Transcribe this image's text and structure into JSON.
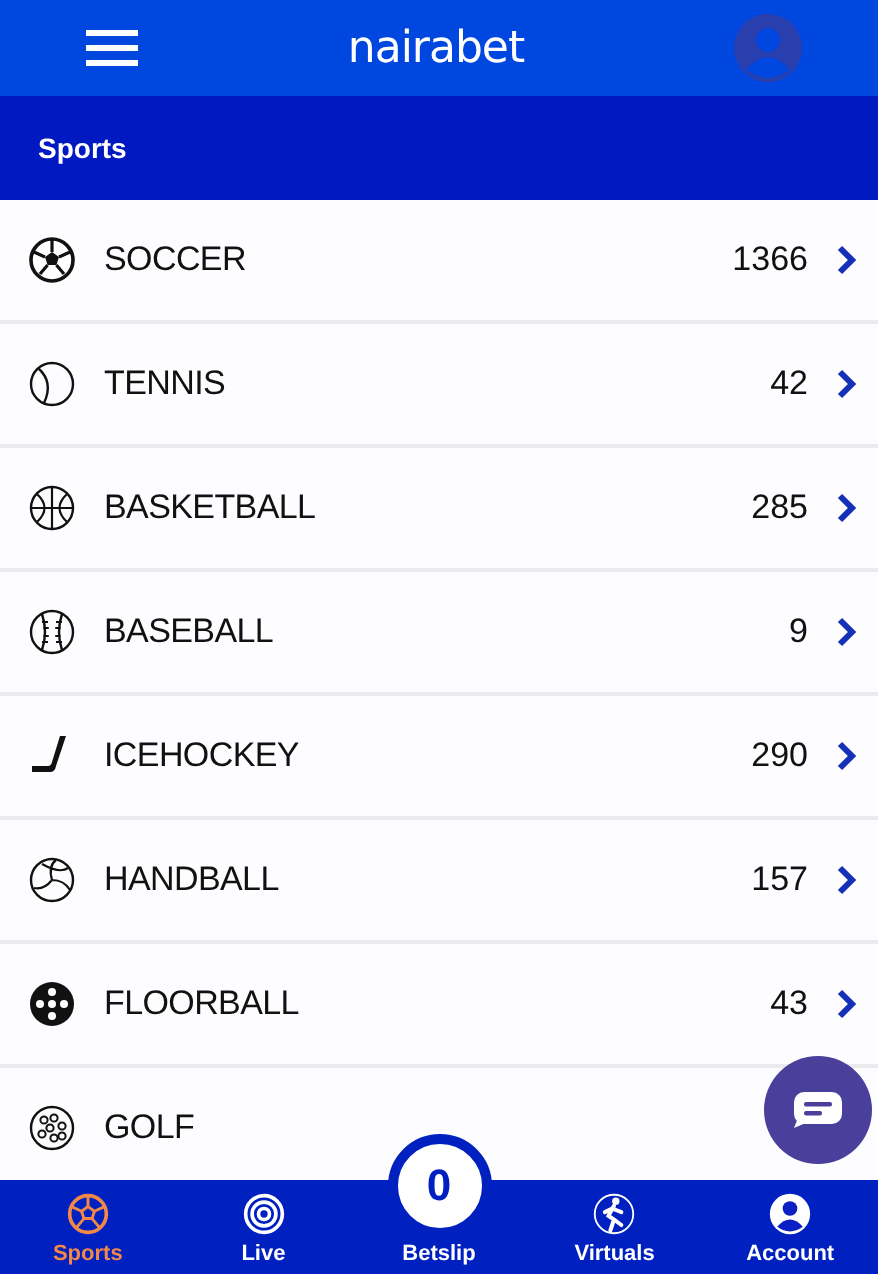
{
  "header": {
    "logo": "nairabet"
  },
  "section_title": "Sports",
  "sports": [
    {
      "name": "SOCCER",
      "count": "1366"
    },
    {
      "name": "TENNIS",
      "count": "42"
    },
    {
      "name": "BASKETBALL",
      "count": "285"
    },
    {
      "name": "BASEBALL",
      "count": "9"
    },
    {
      "name": "ICEHOCKEY",
      "count": "290"
    },
    {
      "name": "HANDBALL",
      "count": "157"
    },
    {
      "name": "FLOORBALL",
      "count": "43"
    },
    {
      "name": "GOLF"
    }
  ],
  "bottom_nav": [
    {
      "label": "Sports",
      "selected": true
    },
    {
      "label": "Live",
      "selected": false
    },
    {
      "label": "Betslip",
      "selected": false,
      "count": "0"
    },
    {
      "label": "Virtuals",
      "selected": false
    },
    {
      "label": "Account",
      "selected": false
    }
  ]
}
